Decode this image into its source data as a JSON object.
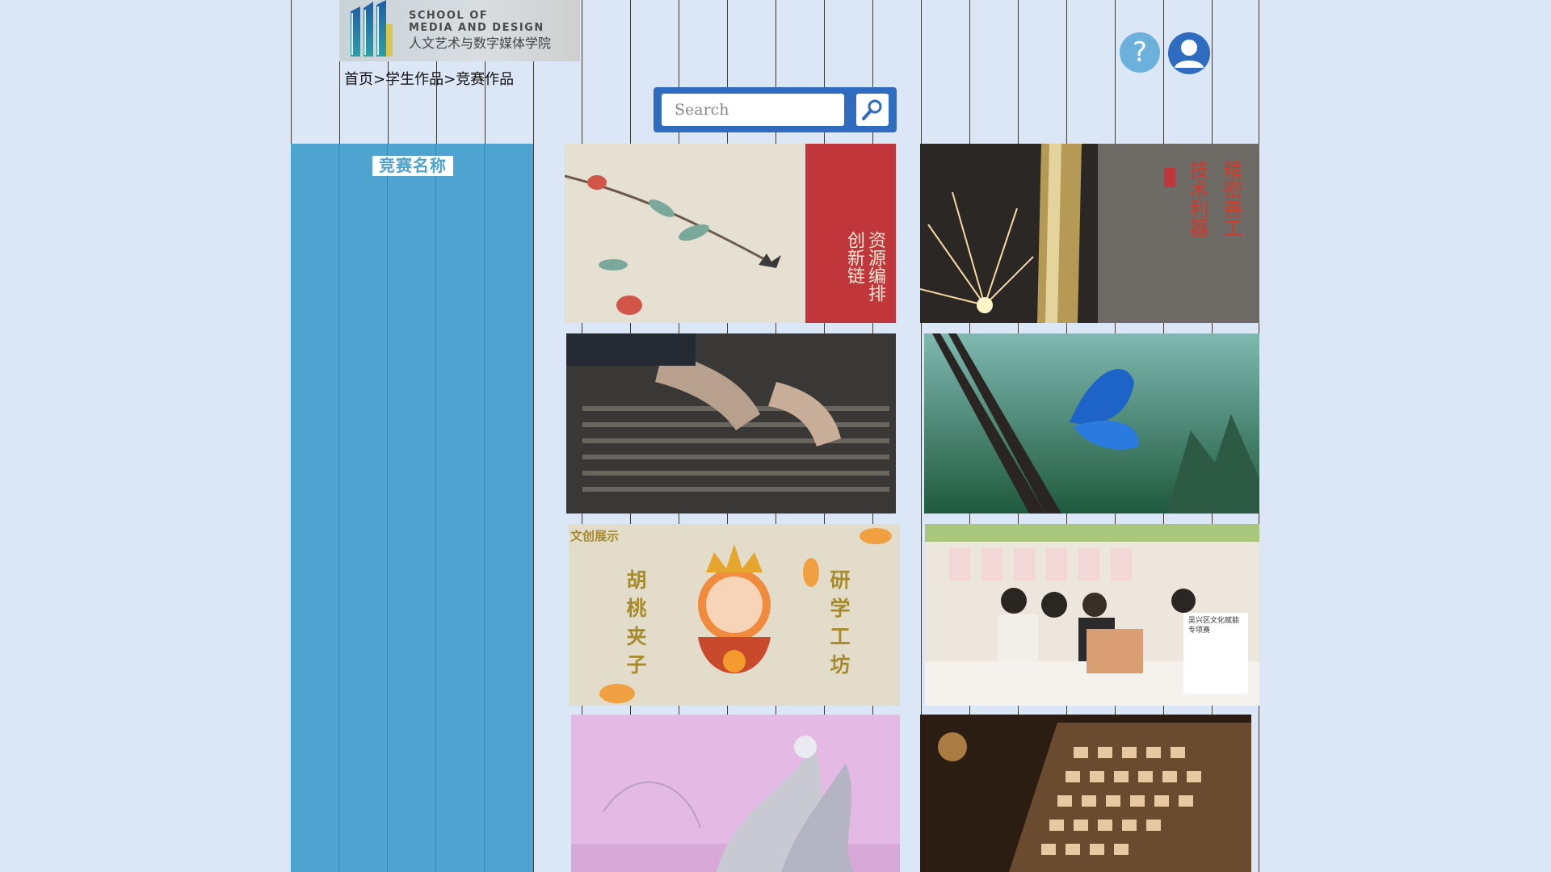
{
  "header": {
    "logo_en_line1": "SCHOOL OF",
    "logo_en_line2": "MEDIA AND DESIGN",
    "logo_cn": "人文艺术与数字媒体学院",
    "breadcrumb": [
      "首页",
      ">",
      "学生作品",
      ">",
      "竞赛作品"
    ]
  },
  "search": {
    "placeholder": "Search",
    "icon": "magnifier-icon"
  },
  "actions": {
    "help_label": "?",
    "help_icon": "question-icon",
    "user_icon": "user-icon"
  },
  "sidebar": {
    "title": "竞赛名称"
  },
  "gallery": {
    "cards": [
      {
        "text_a": "资源编排",
        "text_b": "创新链"
      },
      {
        "text_a": "精密善工",
        "text_b": "技术利器",
        "seal": "传统"
      },
      {
        "text_a": ""
      },
      {
        "text_a": ""
      },
      {
        "tag": "文创展示",
        "text_a": "胡桃夹子",
        "text_b": "研学工坊"
      },
      {
        "banner": "吴兴区文化赋能专项赛"
      },
      {
        "text_a": ""
      },
      {
        "text_a": ""
      }
    ]
  },
  "colors": {
    "background": "#dbe6f6",
    "sidebar": "#4fa3d0",
    "search_box": "#2f6cc0",
    "help_button": "#6cb0dc",
    "user_button": "#2f6cc0"
  }
}
